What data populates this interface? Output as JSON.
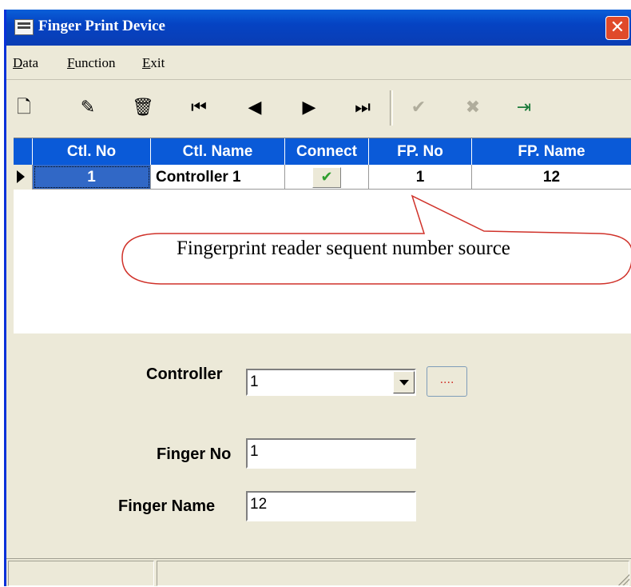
{
  "window": {
    "title": "Finger Print Device",
    "close_glyph": "✕"
  },
  "menu": {
    "items": [
      {
        "accel": "D",
        "rest": "ata"
      },
      {
        "accel": "F",
        "rest": "unction"
      },
      {
        "accel": "E",
        "rest": "xit"
      }
    ]
  },
  "toolbar": {
    "icons": [
      "new-icon",
      "edit-icon",
      "delete-icon",
      "first-icon",
      "prior-icon",
      "next-icon",
      "last-icon",
      "post-icon",
      "cancel-icon",
      "exit-icon"
    ],
    "glyphs": {
      "new": "🗋",
      "edit": "✎",
      "delete": "🗑",
      "first": "⏮",
      "prior": "◀",
      "next": "▶",
      "last": "⏭",
      "post": "✔",
      "cancel": "✖",
      "exit": "⇥"
    }
  },
  "grid": {
    "headers": {
      "ctl_no": "Ctl. No",
      "ctl_name": "Ctl. Name",
      "connect": "Connect",
      "fp_no": "FP. No",
      "fp_name": "FP. Name"
    },
    "rows": [
      {
        "ctl_no": "1",
        "ctl_name": "Controller 1",
        "connect_glyph": "✔",
        "fp_no": "1",
        "fp_name": "12"
      }
    ]
  },
  "callout": {
    "text": "Fingerprint reader sequent number source"
  },
  "form": {
    "controller_label": "Controller",
    "controller_value": "1",
    "ellipsis_label": "....",
    "finger_no_label": "Finger No",
    "finger_no_value": "1",
    "finger_name_label": "Finger Name",
    "finger_name_value": "12"
  },
  "colors": {
    "title_bar": "#0a5fd8",
    "grid_header": "#0a5ad8",
    "callout_border": "#d0322a",
    "check": "#2e9e2e"
  }
}
